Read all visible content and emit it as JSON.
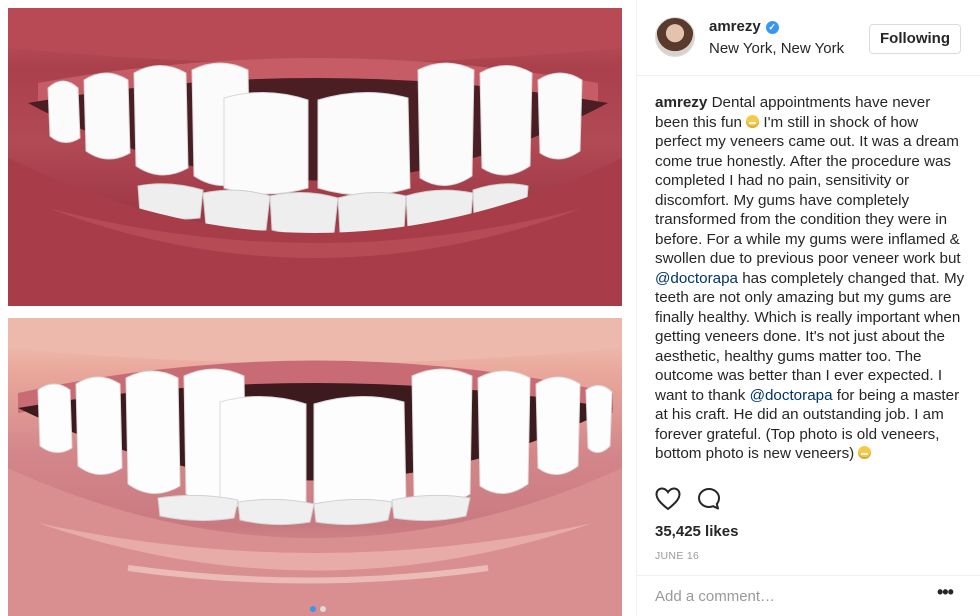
{
  "post": {
    "photo_alt": "smile-comparison",
    "carousel_dots": 2,
    "active_dot": 1
  },
  "header": {
    "username": "amrezy",
    "location": "New York, New York",
    "follow_label": "Following"
  },
  "caption": {
    "author": "amrezy",
    "part1": " Dental appointments have never been this fun ",
    "part2": " I'm still in shock of how perfect my veneers came out. It was a dream come true honestly. After the procedure was completed I had no pain, sensitivity or discomfort. My gums have completely transformed from the condition they were in before. For a while my gums were inflamed & swollen due to previous poor veneer work but ",
    "mention1": "@doctorapa",
    "part3": " has completely changed that. My teeth are not only amazing but my gums are finally healthy. Which is really important when getting veneers done. It's not just about the aesthetic, healthy gums matter too. The outcome was better than I ever expected. I want to thank ",
    "mention2": "@doctorapa",
    "part4": " for being a master at his craft. He did an outstanding job. I am forever grateful. (Top photo is old veneers, bottom photo is new veneers) "
  },
  "stats": {
    "likes": "35,425 likes",
    "date": "JUNE 16"
  },
  "comment": {
    "placeholder": "Add a comment…",
    "more_label": "•••"
  },
  "colors": {
    "accent": "#3897f0",
    "mention": "#003569"
  }
}
